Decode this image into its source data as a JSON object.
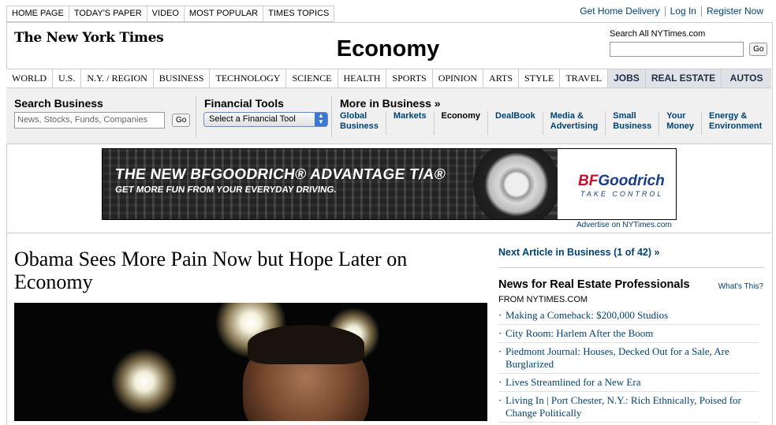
{
  "top_tabs": [
    "HOME PAGE",
    "TODAY'S PAPER",
    "VIDEO",
    "MOST POPULAR",
    "TIMES TOPICS"
  ],
  "utility_links": [
    "Get Home Delivery",
    "Log In",
    "Register Now"
  ],
  "logo": "The New York Times",
  "section_title": "Economy",
  "search_all": {
    "label": "Search All NYTimes.com",
    "value": "",
    "go": "Go"
  },
  "section_nav": [
    "WORLD",
    "U.S.",
    "N.Y. / REGION",
    "BUSINESS",
    "TECHNOLOGY",
    "SCIENCE",
    "HEALTH",
    "SPORTS",
    "OPINION",
    "ARTS",
    "STYLE",
    "TRAVEL"
  ],
  "section_nav_special": [
    "JOBS",
    "REAL ESTATE",
    "AUTOS"
  ],
  "search_business": {
    "title": "Search Business",
    "placeholder": "News, Stocks, Funds, Companies",
    "go": "Go"
  },
  "financial_tools": {
    "title": "Financial Tools",
    "select_value": "Select a Financial Tool"
  },
  "more_in_business": {
    "title": "More in Business »",
    "links": [
      {
        "line1": "Global",
        "line2": "Business"
      },
      {
        "line1": "Markets",
        "line2": ""
      },
      {
        "line1": "Economy",
        "line2": ""
      },
      {
        "line1": "DealBook",
        "line2": ""
      },
      {
        "line1": "Media &",
        "line2": "Advertising"
      },
      {
        "line1": "Small",
        "line2": "Business"
      },
      {
        "line1": "Your",
        "line2": "Money"
      },
      {
        "line1": "Energy &",
        "line2": "Environment"
      }
    ]
  },
  "ad": {
    "line1": "THE NEW BFGOODRICH® ADVANTAGE T/A®",
    "line2": "GET MORE FUN FROM YOUR EVERYDAY DRIVING.",
    "brand_bf": "BF",
    "brand_rest": "Goodrich",
    "tagline": "TAKE CONTROL",
    "advertise": "Advertise on NYTimes.com"
  },
  "article": {
    "headline": "Obama Sees More Pain Now but Hope Later on Economy"
  },
  "rail": {
    "next_article": "Next Article in Business (1 of 42) »",
    "real_estate_heading": "News for Real Estate Professionals",
    "whats_this": "What's This?",
    "from": "FROM NYTIMES.COM",
    "items": [
      "Making a Comeback: $200,000 Studios",
      "City Room: Harlem After the Boom",
      "Piedmont Journal: Houses, Decked Out for a Sale, Are Burglarized",
      "Lives Streamlined for a New Era",
      "Living In | Port Chester, N.Y.: Rich Ethnically, Poised for Change Politically"
    ]
  }
}
